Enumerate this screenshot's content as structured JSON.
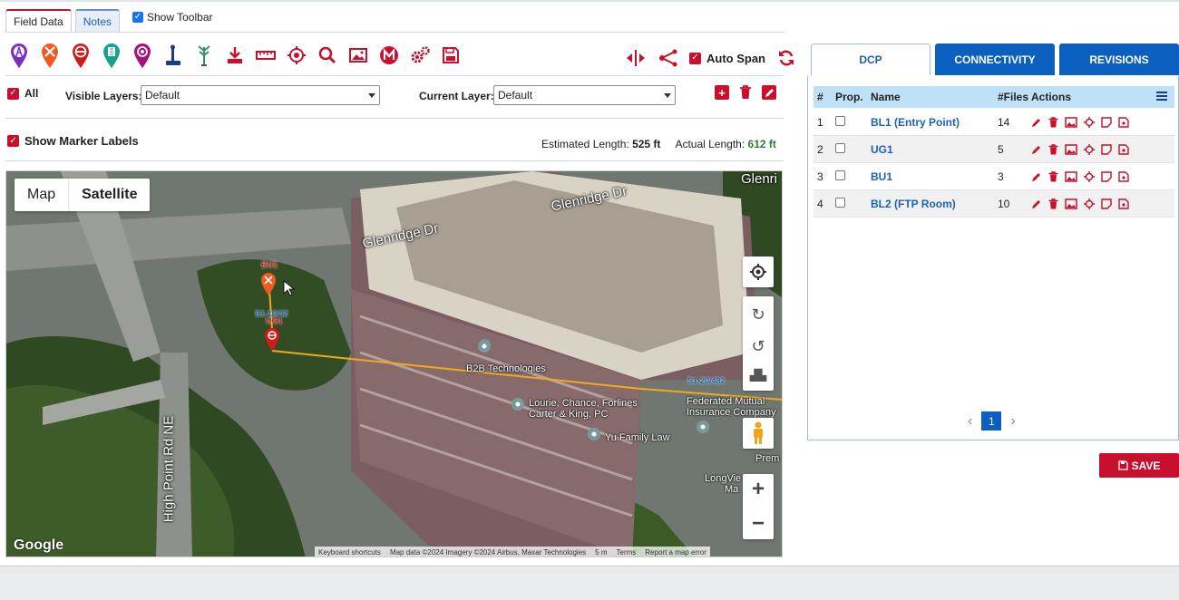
{
  "tabs": [
    {
      "label": "Field Data"
    },
    {
      "label": "Notes"
    }
  ],
  "show_toolbar": {
    "label": "Show Toolbar",
    "checked": true
  },
  "toolbar": {
    "icons": [
      "tower-pin-icon",
      "tools-pin-icon",
      "manhole-pin-icon",
      "building-pin-icon",
      "splice-pin-icon",
      "pole-icon",
      "antenna-icon",
      "download-icon",
      "ruler-icon",
      "target-icon",
      "search-icon",
      "image-icon",
      "m-circle-icon",
      "gears-icon",
      "save-icon"
    ],
    "auto_span_label": "Auto Span",
    "auto_span_checked": true
  },
  "layers": {
    "all_label": "All",
    "visible_label": "Visible Layers:",
    "visible_value": "Default",
    "current_label": "Current Layer:",
    "current_value": "Default"
  },
  "marker_labels": {
    "label": "Show Marker Labels",
    "checked": true
  },
  "lengths": {
    "estimated_label": "Estimated Length:",
    "estimated_value": "525 ft",
    "actual_label": "Actual Length:",
    "actual_value": "612 ft"
  },
  "map": {
    "type_map": "Map",
    "type_satellite": "Satellite",
    "google": "Google",
    "attribution": [
      "Keyboard shortcuts",
      "Map data ©2024 Imagery ©2024 Airbus, Maxar Technologies",
      "5 m",
      "Terms",
      "Report a map error"
    ],
    "roads": [
      "Glenridge Dr",
      "Glenridge Dr",
      "High Point Rd NE",
      "Glenri"
    ],
    "places": [
      "B2B Technologies",
      "Lourie, Chance, Forlines Carter & King, PC",
      "Yu Family Law",
      "Federated Mutual Insurance Company",
      "Prem",
      "LongVie",
      "Ma"
    ],
    "markers": [
      {
        "name": "BU1",
        "span": "S1-10/42"
      },
      {
        "name": "UG1",
        "span": ""
      },
      {
        "name": "",
        "span": "S1-20/482"
      }
    ]
  },
  "panel": {
    "tabs": [
      "DCP",
      "CONNECTIVITY",
      "REVISIONS"
    ],
    "headers": {
      "num": "#",
      "prop": "Prop.",
      "name": "Name",
      "files": "#Files",
      "actions": "Actions"
    },
    "rows": [
      {
        "num": "1",
        "name": "BL1 (Entry Point)",
        "files": "14"
      },
      {
        "num": "2",
        "name": "UG1",
        "files": "5"
      },
      {
        "num": "3",
        "name": "BU1",
        "files": "3"
      },
      {
        "num": "4",
        "name": "BL2 (FTP Room)",
        "files": "10"
      }
    ],
    "page": "1",
    "save_label": "SAVE"
  },
  "colors": {
    "accent_red": "#c8102e",
    "accent_blue": "#0a5fbf",
    "header_blue": "#bfe1f7",
    "actual_green": "#2e7d32"
  }
}
